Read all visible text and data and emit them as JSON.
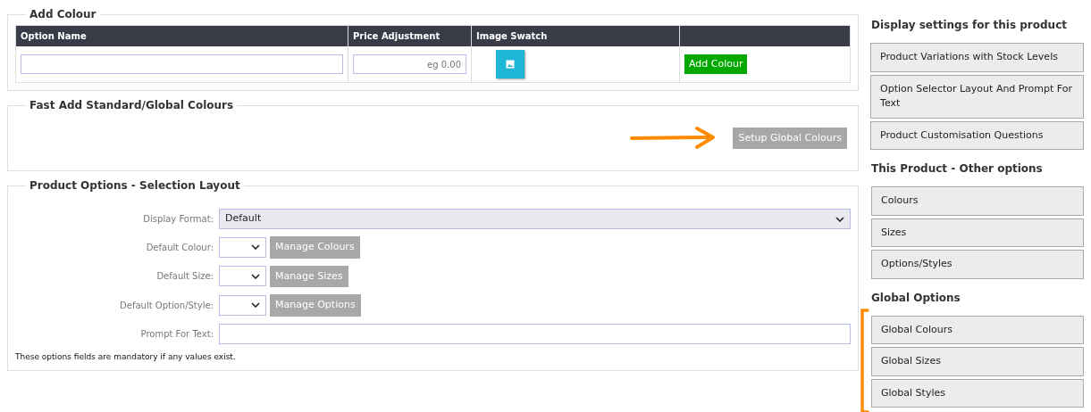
{
  "add_colour": {
    "legend": "Add Colour",
    "columns": [
      "Option Name",
      "Price Adjustment",
      "Image Swatch"
    ],
    "price_placeholder": "eg 0.00",
    "button": "Add Colour"
  },
  "fast_add": {
    "legend": "Fast Add Standard/Global Colours",
    "button": "Setup Global Colours",
    "highlighted": true
  },
  "selection_layout": {
    "legend": "Product Options - Selection Layout",
    "fields": [
      {
        "kind": "select-wide",
        "label": "Display Format:",
        "value": "Default"
      },
      {
        "kind": "select-button",
        "label": "Default Colour:",
        "button": "Manage Colours"
      },
      {
        "kind": "select-button",
        "label": "Default Size:",
        "button": "Manage Sizes"
      },
      {
        "kind": "select-button",
        "label": "Default Option/Style:",
        "button": "Manage Options"
      },
      {
        "kind": "text",
        "label": "Prompt For Text:"
      }
    ],
    "note": "These options fields are mandatory if any values exist."
  },
  "sidebar": {
    "sections": [
      {
        "heading": "Display settings for this product",
        "highlighted": false,
        "items": [
          {
            "label": "Product Variations with Stock Levels"
          },
          {
            "label": "Option Selector Layout And Prompt For Text"
          },
          {
            "label": "Product Customisation Questions"
          }
        ]
      },
      {
        "heading": "This Product - Other options",
        "highlighted": false,
        "items": [
          {
            "label": "Colours"
          },
          {
            "label": "Sizes"
          },
          {
            "label": "Options/Styles"
          }
        ]
      },
      {
        "heading": "Global Options",
        "highlighted": true,
        "items": [
          {
            "label": "Global Colours"
          },
          {
            "label": "Global Sizes"
          },
          {
            "label": "Global Styles"
          }
        ]
      }
    ]
  }
}
